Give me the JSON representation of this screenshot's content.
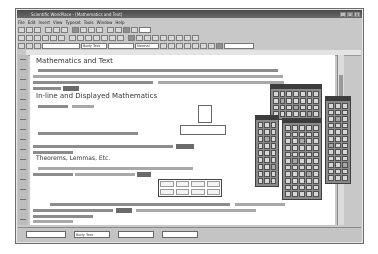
{
  "window": {
    "title": "Scientific WorkPlace - [Mathematics and Text]"
  },
  "menu": [
    "File",
    "Edit",
    "Insert",
    "View",
    "Typeset",
    "Tools",
    "Window",
    "Help"
  ],
  "toolbar": {
    "tag_field": "Body Text",
    "font_field": "Normal"
  },
  "document": {
    "heading1": "Mathematics and Text",
    "heading2": "In-line and Displayed Mathematics",
    "heading3": "Theorems, Lemmas, Etc."
  },
  "statusbar": {
    "fields": [
      "",
      "Body Text",
      "",
      ""
    ]
  },
  "colors": {
    "window_bg": "#c8c8c8",
    "palette_bg": "#8a8a8a",
    "title_bg": "#4a4a4a"
  }
}
